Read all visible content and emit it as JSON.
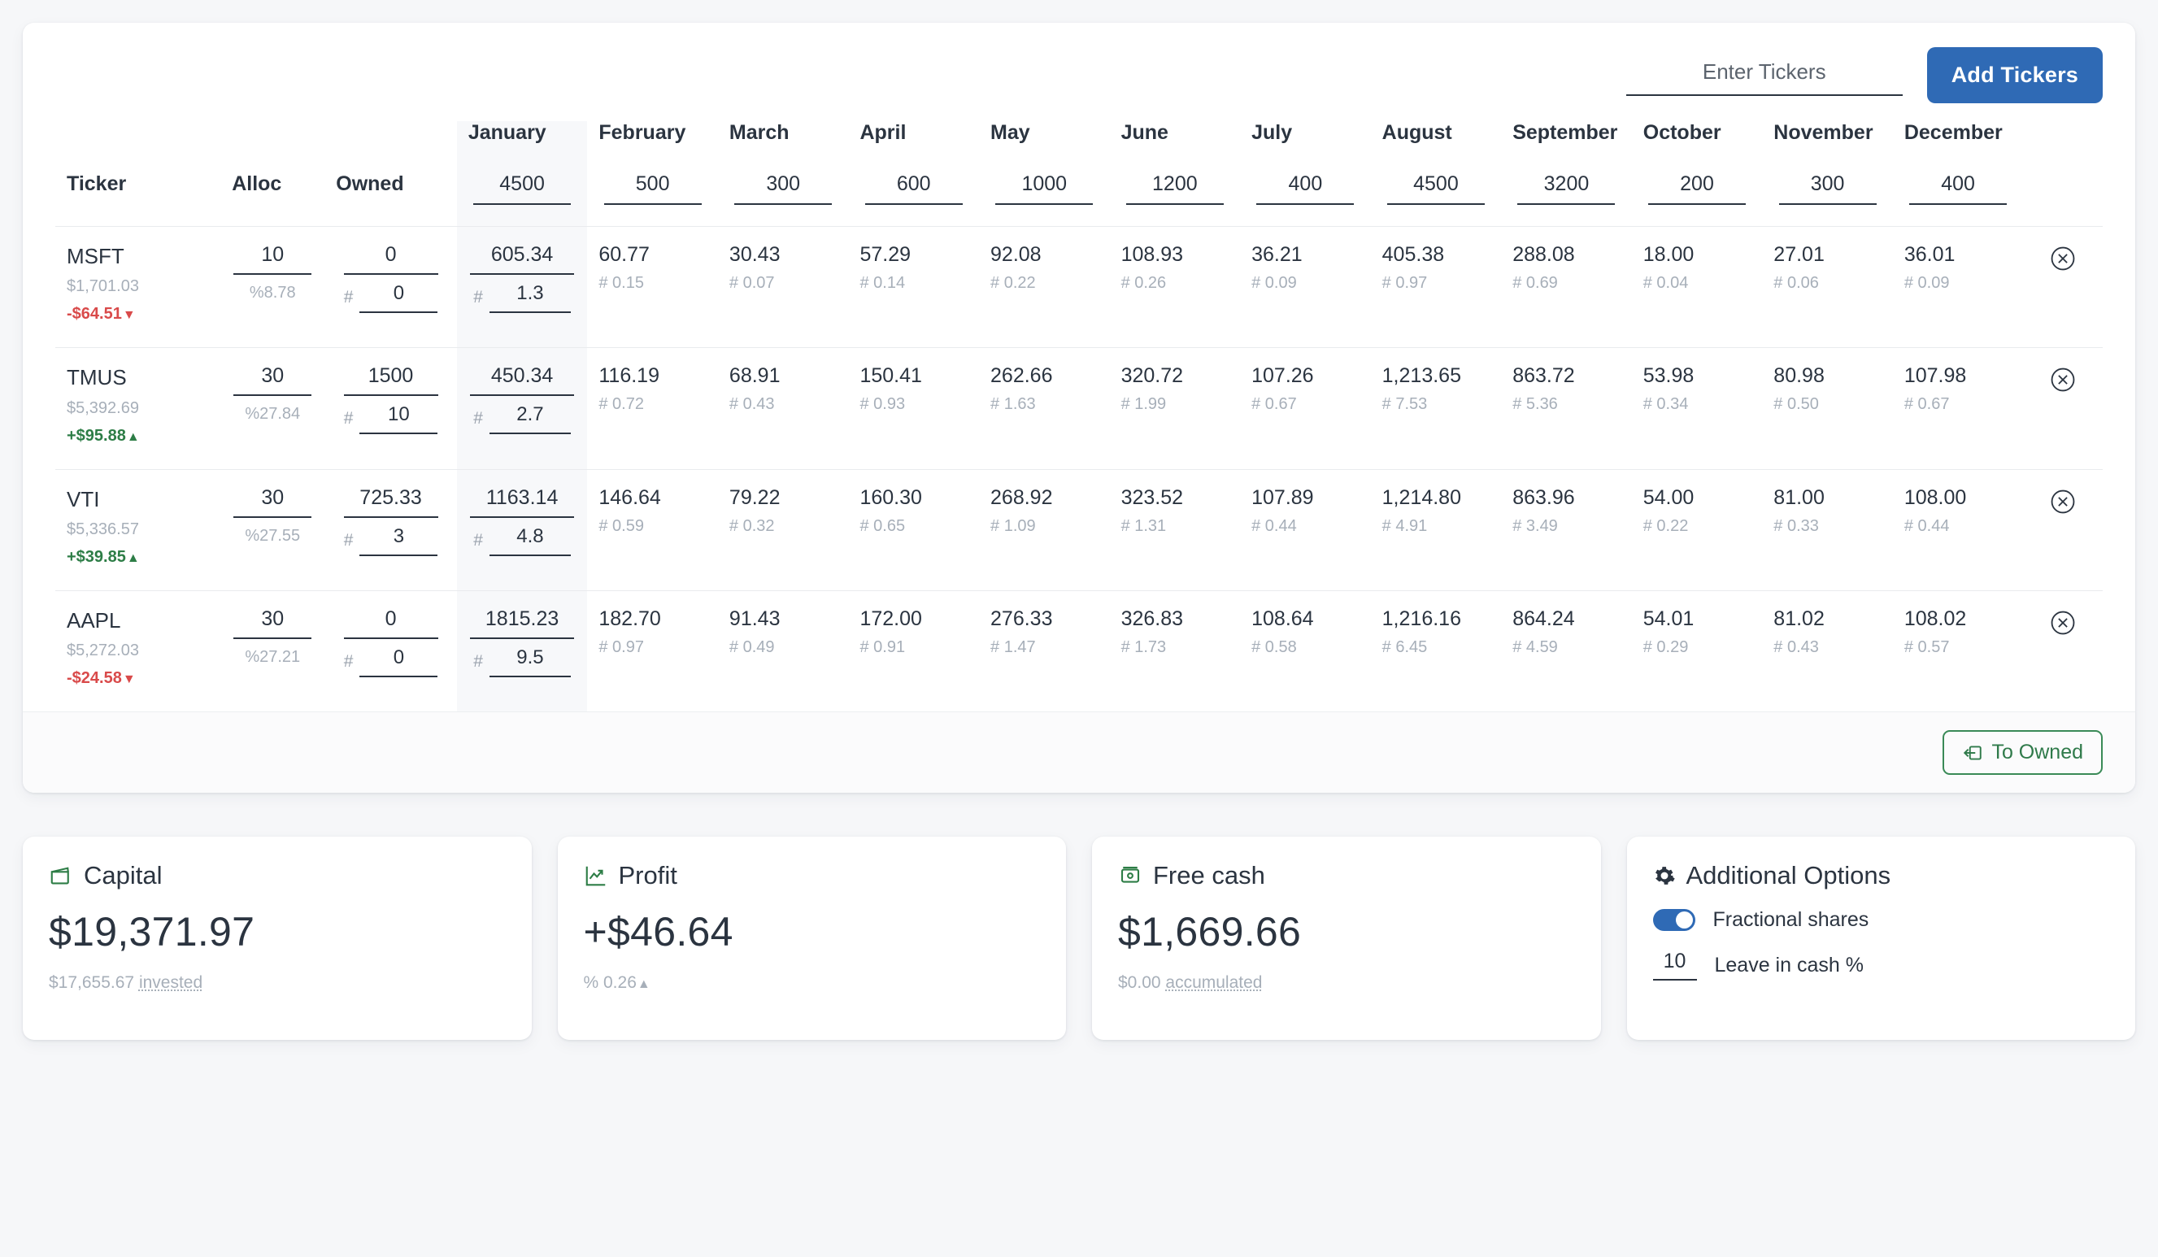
{
  "toolbar": {
    "ticker_placeholder": "Enter Tickers",
    "ticker_value": "",
    "add_label": "Add Tickers"
  },
  "table": {
    "headers": {
      "ticker": "Ticker",
      "alloc": "Alloc",
      "owned": "Owned"
    },
    "months": [
      "January",
      "February",
      "March",
      "April",
      "May",
      "June",
      "July",
      "August",
      "September",
      "October",
      "November",
      "December"
    ],
    "budgets": [
      "4500",
      "500",
      "300",
      "600",
      "1000",
      "1200",
      "400",
      "4500",
      "3200",
      "200",
      "300",
      "400"
    ],
    "rows": [
      {
        "ticker": "MSFT",
        "value": "$1,701.03",
        "delta": "-$64.51",
        "delta_dir": "down",
        "delta_glyph": "▼",
        "alloc": "10",
        "alloc_pct": "%8.78",
        "owned": "0",
        "owned_shares": "0",
        "jan_amount": "605.34",
        "jan_shares": "1.3",
        "amounts": [
          "605.34",
          "60.77",
          "30.43",
          "57.29",
          "92.08",
          "108.93",
          "36.21",
          "405.38",
          "288.08",
          "18.00",
          "27.01",
          "36.01"
        ],
        "shares": [
          "1.3",
          "# 0.15",
          "# 0.07",
          "# 0.14",
          "# 0.22",
          "# 0.26",
          "# 0.09",
          "# 0.97",
          "# 0.69",
          "# 0.04",
          "# 0.06",
          "# 0.09"
        ]
      },
      {
        "ticker": "TMUS",
        "value": "$5,392.69",
        "delta": "+$95.88",
        "delta_dir": "up",
        "delta_glyph": "▲",
        "alloc": "30",
        "alloc_pct": "%27.84",
        "owned": "1500",
        "owned_shares": "10",
        "jan_amount": "450.34",
        "jan_shares": "2.7",
        "amounts": [
          "450.34",
          "116.19",
          "68.91",
          "150.41",
          "262.66",
          "320.72",
          "107.26",
          "1,213.65",
          "863.72",
          "53.98",
          "80.98",
          "107.98"
        ],
        "shares": [
          "2.7",
          "# 0.72",
          "# 0.43",
          "# 0.93",
          "# 1.63",
          "# 1.99",
          "# 0.67",
          "# 7.53",
          "# 5.36",
          "# 0.34",
          "# 0.50",
          "# 0.67"
        ]
      },
      {
        "ticker": "VTI",
        "value": "$5,336.57",
        "delta": "+$39.85",
        "delta_dir": "up",
        "delta_glyph": "▲",
        "alloc": "30",
        "alloc_pct": "%27.55",
        "owned": "725.33",
        "owned_shares": "3",
        "jan_amount": "1163.14",
        "jan_shares": "4.8",
        "amounts": [
          "1163.14",
          "146.64",
          "79.22",
          "160.30",
          "268.92",
          "323.52",
          "107.89",
          "1,214.80",
          "863.96",
          "54.00",
          "81.00",
          "108.00"
        ],
        "shares": [
          "4.8",
          "# 0.59",
          "# 0.32",
          "# 0.65",
          "# 1.09",
          "# 1.31",
          "# 0.44",
          "# 4.91",
          "# 3.49",
          "# 0.22",
          "# 0.33",
          "# 0.44"
        ]
      },
      {
        "ticker": "AAPL",
        "value": "$5,272.03",
        "delta": "-$24.58",
        "delta_dir": "down",
        "delta_glyph": "▼",
        "alloc": "30",
        "alloc_pct": "%27.21",
        "owned": "0",
        "owned_shares": "0",
        "jan_amount": "1815.23",
        "jan_shares": "9.5",
        "amounts": [
          "1815.23",
          "182.70",
          "91.43",
          "172.00",
          "276.33",
          "326.83",
          "108.64",
          "1,216.16",
          "864.24",
          "54.01",
          "81.02",
          "108.02"
        ],
        "shares": [
          "9.5",
          "# 0.97",
          "# 0.49",
          "# 0.91",
          "# 1.47",
          "# 1.73",
          "# 0.58",
          "# 6.45",
          "# 4.59",
          "# 0.29",
          "# 0.43",
          "# 0.57"
        ]
      }
    ],
    "hash_symbol": "#",
    "to_owned_label": "To Owned"
  },
  "cards": {
    "capital": {
      "title": "Capital",
      "icon": "wallet-icon",
      "amount": "$19,371.97",
      "sub_amount": "$17,655.67",
      "sub_word": "invested"
    },
    "profit": {
      "title": "Profit",
      "icon": "trend-up-icon",
      "amount": "+$46.64",
      "sub": "% 0.26",
      "sub_glyph": "▲"
    },
    "free_cash": {
      "title": "Free cash",
      "icon": "cash-icon",
      "amount": "$1,669.66",
      "sub_amount": "$0.00",
      "sub_word": "accumulated"
    },
    "options": {
      "title": "Additional Options",
      "icon": "gear-icon",
      "fractional_label": "Fractional shares",
      "fractional_on": true,
      "cash_value": "10",
      "cash_label": "Leave in cash %"
    }
  },
  "colors": {
    "accent": "#2f6ab5",
    "green": "#2d7d46",
    "red": "#d94a4a",
    "text": "#2b3440",
    "muted": "#a7afb9"
  }
}
